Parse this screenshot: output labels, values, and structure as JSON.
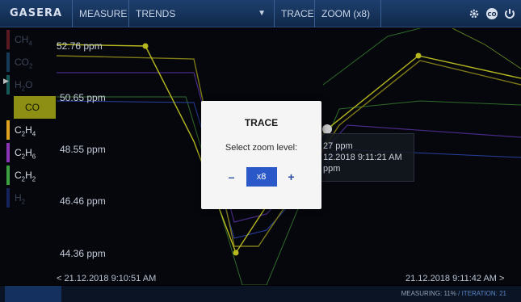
{
  "topbar": {
    "logo": "GASERA",
    "measure": "MEASURE",
    "trends": "TRENDS",
    "trace": "TRACE",
    "zoom": "ZOOM (x8)"
  },
  "gases": [
    {
      "label": "CH4",
      "color": "#7a1f2a",
      "dim": true
    },
    {
      "label": "CO2",
      "color": "#1f4a6a",
      "dim": true
    },
    {
      "label": "H2O",
      "color": "#1f6a6a",
      "dim": true
    },
    {
      "label": "CO",
      "color": "#b7b81e",
      "dim": false,
      "active": true
    },
    {
      "label": "C2H4",
      "color": "#e0a020",
      "dim": false
    },
    {
      "label": "C2H6",
      "color": "#8a35b8",
      "dim": false
    },
    {
      "label": "C2H2",
      "color": "#3aa040",
      "dim": false
    },
    {
      "label": "H2",
      "color": "#1a2a6a",
      "dim": true
    }
  ],
  "y_labels": [
    "52.76 ppm",
    "50.65 ppm",
    "48.55 ppm",
    "46.46 ppm",
    "44.36 ppm"
  ],
  "x_start": "< 21.12.2018 9:10:51 AM",
  "x_end": "21.12.2018 9:11:42 AM >",
  "tooltip": {
    "line1": "27 ppm",
    "line2": "12.2018 9:11:21 AM",
    "line3": "ppm"
  },
  "modal": {
    "title": "TRACE",
    "message": "Select zoom level:",
    "minus": "–",
    "value": "x8",
    "plus": "+"
  },
  "status": {
    "measuring": "MEASURING: 11%",
    "sep": " / ",
    "iteration": "ITERATION: 21"
  }
}
